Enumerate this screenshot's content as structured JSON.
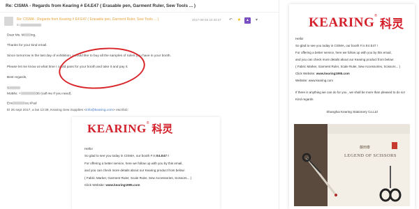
{
  "email": {
    "subject": "Re: CISMA - Regards from Kearing # E4.E47 ( Erasable pen, Garment Ruler, Sew Tools ... )",
    "sender_line": "Re: CISMA - Regards from Kearing # E4.E47 ( Erasable pen, Garment Ruler, Sew Tools ... )",
    "date": "2017-09-28 22:33:27",
    "greeting_prefix": "Dear Ms. M",
    "greeting_suffix": "ing,",
    "thanks": "Thanks for your kind email.",
    "para1": "Since tomorrow is the last day of exhibition, I would like to buy all the samples of rulers you have in your booth.",
    "para2_a": "Please let me know at what time",
    "para2_b": "I could pass for your booth and take it and pay it.",
    "regards": "Best regards,",
    "sign_name": "S",
    "mobile_prefix": "Mobile: +",
    "mobile_suffix": "36 (call me if you need).",
    "sent_prefix": "Env",
    "sent_suffix": "eu iPad",
    "quote_prefix": "El 26 sept 2017, a las 13:39, Kearing Sew Supplies <",
    "quote_email": "info@kearing.com",
    "quote_suffix": "> escribió:"
  },
  "brand": {
    "name_en": "KEARING",
    "name_cn": "科灵",
    "reg_mark": "®",
    "color": "#d4202a"
  },
  "card": {
    "hello": "Hello!",
    "line1_a": "So glad to see you today in CISMA, our booth # is ",
    "line1_b": "E4.E47 !",
    "line2": "For offering a better service, here we follow up with you by this email,",
    "line3": "and you can check more details about our Kearing product from below:",
    "line4": "( Fabric Marker, Garment Ruler, Scale Ruler, Sew Accessories, Scissors... )",
    "line5_label": "Click Website:",
    "line5_url": "www.kearing1995.com"
  },
  "flyer": {
    "hello": "Hello!",
    "line1": "So glad to see you today in CISMA, our booth # is E4.E47 !",
    "line2": "For offering a better service, here we follow up with you by this email,",
    "line3": "and you can check more details about our Kearing product from below:",
    "line4": "( Fabric Marker, Garment Ruler, Scale Ruler, Sew Accessories, Scissors... )",
    "line5_label": "Click Website:",
    "line5_url": "www.kearing1995.com",
    "line6_label": "Website:",
    "line6_url": "www.kearing.com",
    "line7": "If there is anything we can do for you , we shall be more than pleased to do so!",
    "line8": "Kind regards",
    "footer": "Shanghai Kearing Stationery Co.Ltd",
    "catalog_title": "LEGEND OF SCISSORS",
    "catalog_cn": "藤田泰"
  }
}
